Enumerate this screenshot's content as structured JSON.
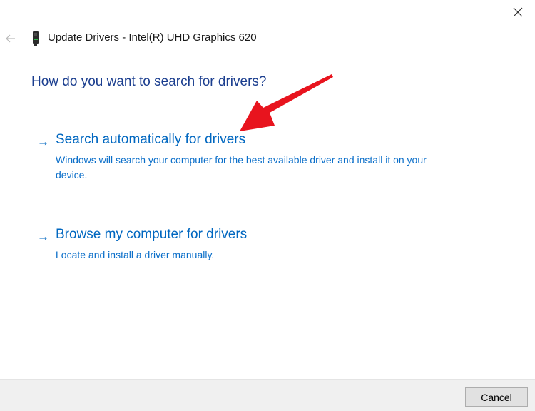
{
  "window": {
    "title": "Update Drivers - Intel(R) UHD Graphics 620"
  },
  "icons": {
    "back": "back-arrow-icon",
    "device": "graphics-card-icon",
    "close": "close-icon"
  },
  "main": {
    "heading": "How do you want to search for drivers?",
    "options": [
      {
        "label": "Search automatically for drivers",
        "description": "Windows will search your computer for the best available driver and install it on your device."
      },
      {
        "label": "Browse my computer for drivers",
        "description": "Locate and install a driver manually."
      }
    ]
  },
  "footer": {
    "cancel_label": "Cancel"
  },
  "colors": {
    "heading": "#1b3e8f",
    "link": "#0067c0",
    "annotation": "#e8141e",
    "footer_bg": "#f0f0f0"
  }
}
